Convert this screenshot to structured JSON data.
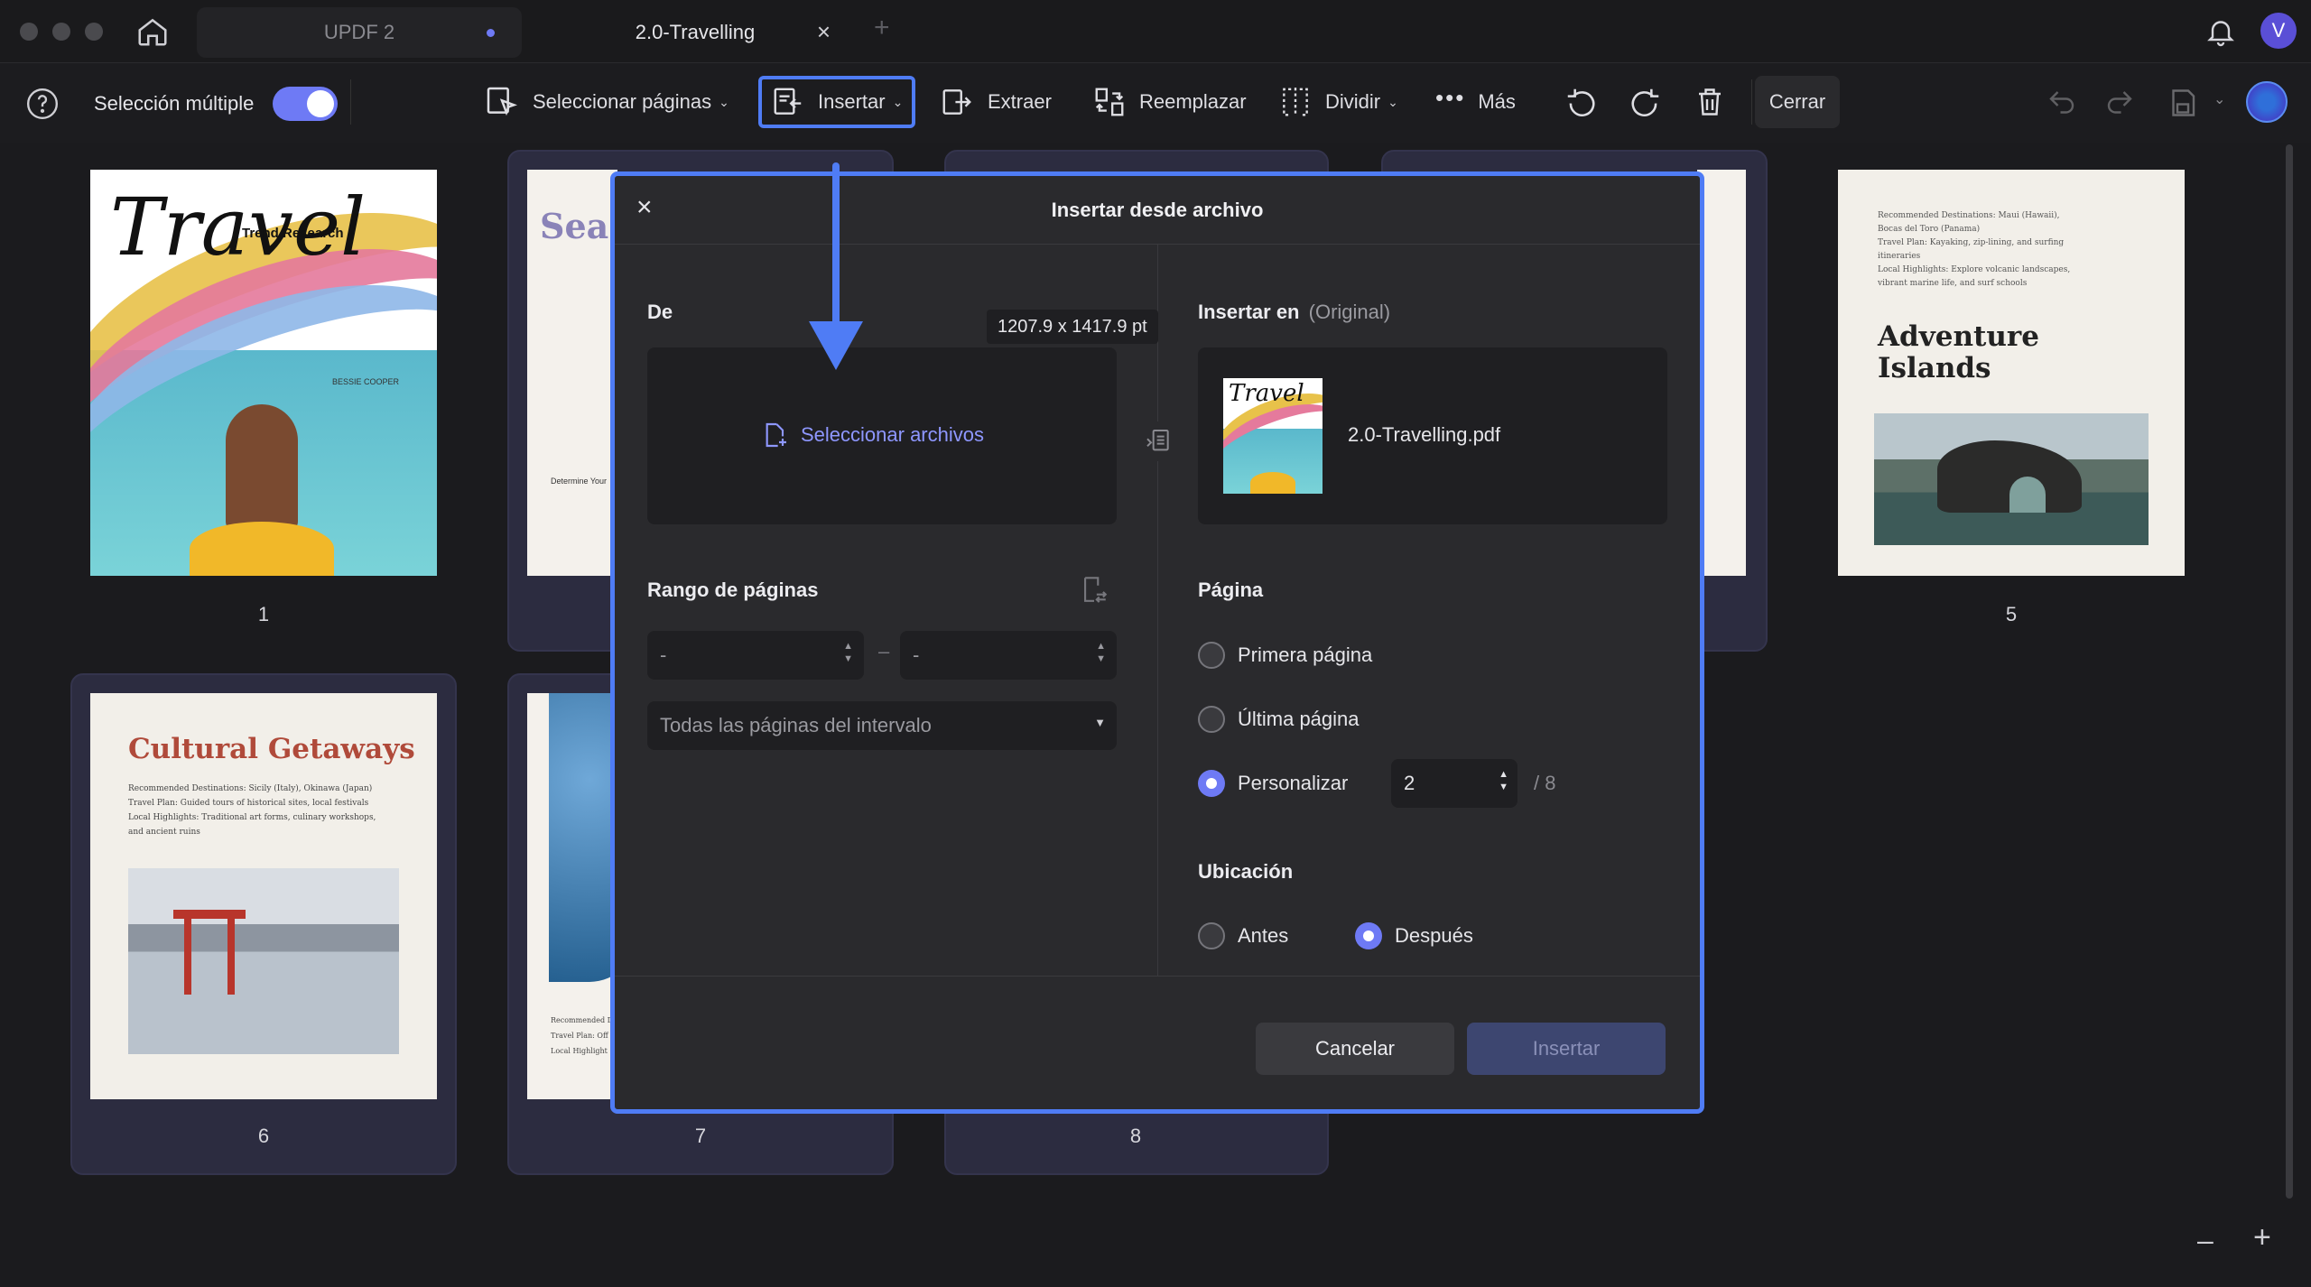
{
  "tabs": {
    "inactive": "UPDF 2",
    "active": "2.0-Travelling",
    "new_tab": "+",
    "close": "×"
  },
  "user_avatar": "V",
  "toolbar": {
    "multi_select_label": "Selección múltiple",
    "select_pages": "Seleccionar páginas",
    "insert": "Insertar",
    "extract": "Extraer",
    "replace": "Reemplazar",
    "split": "Dividir",
    "more": "Más",
    "close": "Cerrar"
  },
  "pages": [
    {
      "num": "1",
      "title": "Travel",
      "subtitle": "Trend Research",
      "author": "BESSIE COOPER"
    },
    {
      "num": "5",
      "title": "Adventure Islands",
      "lines": [
        "Recommended Destinations: Maui (Hawaii),",
        "Bocas del Toro (Panama)",
        "Travel Plan: Kayaking, zip-lining, and surfing",
        "itineraries",
        "Local Highlights: Explore volcanic landscapes,",
        "vibrant marine life, and surf schools"
      ]
    },
    {
      "num": "6",
      "title": "Cultural Getaways",
      "lines": [
        "Recommended Destinations: Sicily (Italy), Okinawa (Japan)",
        "Travel Plan: Guided tours of historical sites, local festivals",
        "Local Highlights: Traditional art forms, culinary workshops,",
        "and ancient ruins"
      ]
    },
    {
      "num": "7",
      "title": ""
    },
    {
      "num": "8",
      "title": ""
    }
  ],
  "page2_partial": {
    "title": "Sea",
    "sub": "Determine Your"
  },
  "page7_partial": {
    "lines": [
      "Recommended D",
      "Travel Plan: Off",
      "Local Highlight"
    ]
  },
  "modal": {
    "title": "Insertar desde archivo",
    "close": "×",
    "from_label": "De",
    "dimension_tooltip": "1207.9 x 1417.9 pt",
    "select_files": "Seleccionar archivos",
    "insert_in_label": "Insertar en",
    "insert_in_sub": "(Original)",
    "target_file": "2.0-Travelling.pdf",
    "page_range_label": "Rango de páginas",
    "range_from": "-",
    "range_to": "-",
    "range_dash": "–",
    "range_option": "Todas las páginas del intervalo",
    "page_label": "Página",
    "first_page": "Primera página",
    "last_page": "Última página",
    "custom": "Personalizar",
    "custom_value": "2",
    "custom_total": "/ 8",
    "location_label": "Ubicación",
    "before": "Antes",
    "after": "Después",
    "cancel": "Cancelar",
    "insert_btn": "Insertar"
  },
  "zoom": {
    "minus": "–",
    "plus": "+"
  },
  "colors": {
    "accent": "#4f7cf5",
    "radio_on": "#6e7af5",
    "toggle_on": "#6e7af5"
  }
}
